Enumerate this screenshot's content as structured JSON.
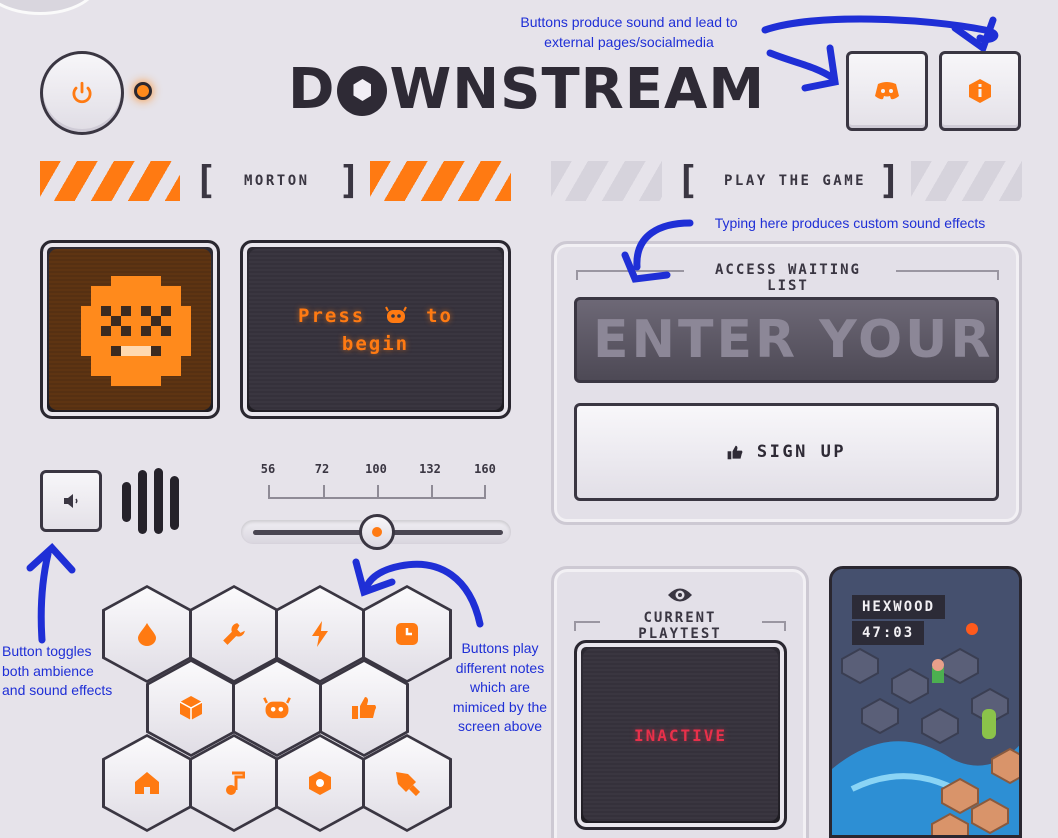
{
  "annotations": {
    "buttons_top": "Buttons produce sound and lead to external pages/socialmedia",
    "typing": "Typing here produces custom sound effects",
    "toggle": "Button toggles both ambience and sound effects",
    "notes": "Buttons play different notes which are mimiced by the screen above"
  },
  "header": {
    "logo_text": "DOWNSTREAM",
    "logo_parts": [
      "D",
      "WNSTREAM"
    ],
    "power_icon": "power-icon",
    "discord_icon": "discord-icon",
    "info_icon": "info-icon"
  },
  "sections": {
    "left_label": "MORTON",
    "right_label": "PLAY THE GAME"
  },
  "screens": {
    "press_line1": "Press",
    "press_line2": "to",
    "press_line3": "begin"
  },
  "slider": {
    "ticks": [
      "56",
      "72",
      "100",
      "132",
      "160"
    ],
    "value": 100
  },
  "waiting_list": {
    "title": "ACCESS WAITING LIST",
    "email_placeholder": "ENTER YOUR E",
    "signup_label": "SIGN UP"
  },
  "playtest": {
    "title": "CURRENT PLAYTEST",
    "status": "INACTIVE"
  },
  "game": {
    "name": "HEXWOOD",
    "time": "47:03"
  },
  "hex_buttons": [
    "drop-icon",
    "wrench-icon",
    "bolt-icon",
    "clock-icon",
    "cube-icon",
    "robot-icon",
    "thumbs-up-icon",
    "home-icon",
    "music-icon",
    "hexagon-icon",
    "sword-icon"
  ],
  "colors": {
    "accent": "#ff7a12",
    "dark": "#2e2a35",
    "background": "#e6e3ea",
    "annotation": "#1f2fd6",
    "inactive": "#e8304a"
  }
}
